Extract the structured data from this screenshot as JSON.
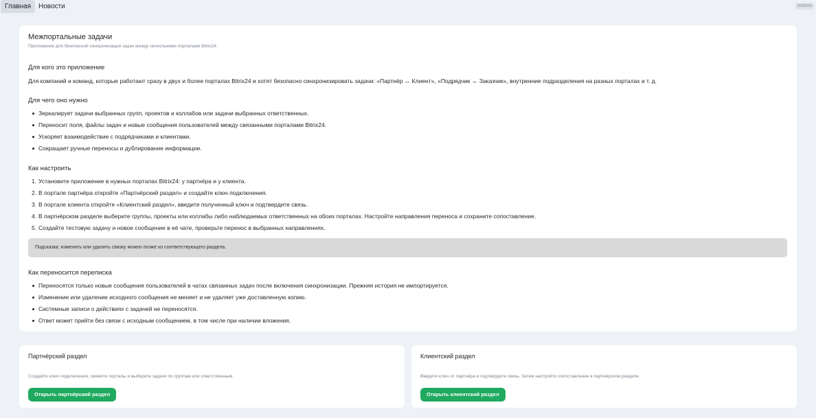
{
  "nav": {
    "tabs": [
      {
        "label": "Главная",
        "active": true
      },
      {
        "label": "Новости",
        "active": false
      }
    ],
    "version": "2026019"
  },
  "main": {
    "title": "Межпортальные задачи",
    "subtitle": "Приложение для безопасной синхронизации задач между несколькими порталами Bitrix24.",
    "audience": {
      "heading": "Для кого это приложение",
      "text": "Для компаний и команд, которые работают сразу в двух и более порталах Bitrix24 и хотят безопасно синхронизировать задачи: «Партнёр ↔ Клиент», «Подрядчик ↔ Заказчик», внутренние подразделения на разных порталах и т. д."
    },
    "purpose": {
      "heading": "Для чего оно нужно",
      "items": [
        "Зеркалирует задачи выбранных групп, проектов и коллабов или задачи выбранных ответственных.",
        "Переносит поля, файлы задач и новые сообщения пользователей между связанными порталами Bitrix24.",
        "Ускоряет взаимодействие с подрядчиками и клиентами.",
        "Сокращает ручные переносы и дублирование информации."
      ]
    },
    "setup": {
      "heading": "Как настроить",
      "steps": [
        "Установите приложение в нужных порталах Bitrix24: у партнёра и у клиента.",
        "В портале партнёра откройте «Партнёрский раздел» и создайте ключ подключения.",
        "В портале клиента откройте «Клиентский раздел», введите полученный ключ и подтвердите связь.",
        "В партнёрском разделе выберите группы, проекты или коллабы либо наблюдаемых ответственных на обоих порталах. Настройте направления переноса и сохраните сопоставление.",
        "Создайте тестовую задачу и новое сообщение в её чате, проверьте перенос в выбранных направлениях."
      ],
      "hint": "Подсказка: изменить или удалить связку можно позже из соответствующего раздела."
    },
    "chat": {
      "heading": "Как переносится переписка",
      "items": [
        "Переносятся только новые сообщения пользователей в чатах связанных задач после включения синхронизации. Прежняя история не импортируется.",
        "Изменение или удаление исходного сообщения не меняет и не удаляет уже доставленную копию.",
        "Системные записи о действиях с задачей не переносятся.",
        "Ответ может прийти без связи с исходным сообщением, в том числе при наличии вложения."
      ]
    }
  },
  "partner": {
    "title": "Партнёрский раздел",
    "description": "Создайте ключ подключения, свяжите порталы и выберите задачи по группам или ответственным.",
    "button": "Открыть партнёрский раздел"
  },
  "client": {
    "title": "Клиентский раздел",
    "description": "Введите ключ от партнёра и подтвердите связь. Затем настройте сопоставление в партнёрском разделе.",
    "button": "Открыть клиентский раздел"
  },
  "colors": {
    "page_bg": "#eef2f6",
    "card_bg": "#ffffff",
    "accent_green": "#1faa5f",
    "hint_bg": "#d9d9d9"
  }
}
